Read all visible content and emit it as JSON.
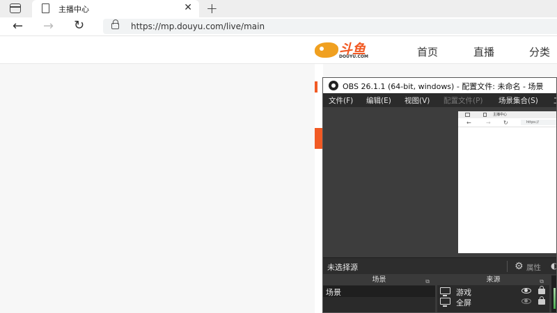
{
  "browser": {
    "tab_title": "主播中心",
    "tab_close": "✕",
    "new_tab": "+",
    "url": "https://mp.douyu.com/live/main",
    "back": "←",
    "forward": "→",
    "reload": "↻"
  },
  "site": {
    "logo_text": "斗鱼",
    "logo_sub": "DOUYU.COM",
    "nav": [
      "首页",
      "直播",
      "分类"
    ],
    "accent_color": "#f15a24"
  },
  "obs": {
    "title": "OBS 26.1.1 (64-bit, windows) - 配置文件: 未命名 - 场景",
    "menu": [
      "文件(F)",
      "编辑(E)",
      "视图(V)",
      "配置文件(P)",
      "场景集合(S)",
      "工"
    ],
    "preview": {
      "tab_title": "主播中心",
      "url": "https://"
    },
    "status_label": "未选择源",
    "properties_label": "属性",
    "scenes_header": "场景",
    "scenes": [
      "场景"
    ],
    "sources_header": "来源",
    "sources": [
      {
        "name": "游戏",
        "visible": true
      },
      {
        "name": "全屏",
        "visible": false
      }
    ]
  }
}
